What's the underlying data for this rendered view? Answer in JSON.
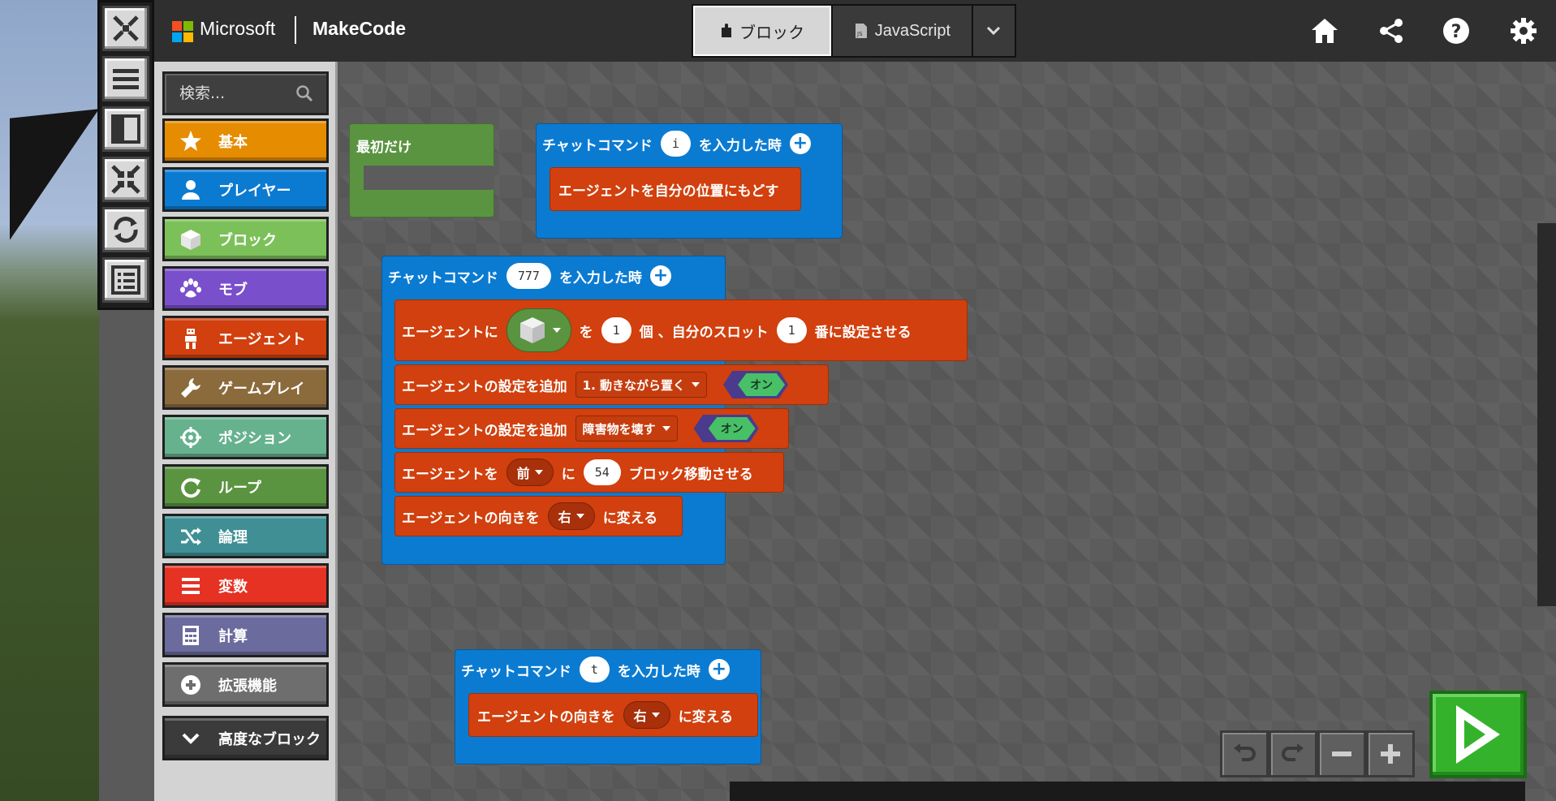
{
  "header": {
    "brand_microsoft": "Microsoft",
    "brand_product": "MakeCode",
    "editor_tabs": [
      {
        "label": "ブロック",
        "icon": "puzzle-icon",
        "active": true
      },
      {
        "label": "JavaScript",
        "icon": "js-file-icon",
        "active": false
      }
    ],
    "more_icon": "chevron-down-icon",
    "actions": [
      "home-icon",
      "share-icon",
      "help-icon",
      "settings-icon"
    ]
  },
  "minecraft_tools": [
    "close-icon",
    "menu-icon",
    "split-view-icon",
    "minimize-icon",
    "refresh-icon",
    "list-icon"
  ],
  "toolbox": {
    "search_placeholder": "検索...",
    "categories": [
      {
        "label": "基本",
        "color": "#e68c00",
        "icon": "star-icon"
      },
      {
        "label": "プレイヤー",
        "color": "#0b7bd2",
        "icon": "user-icon"
      },
      {
        "label": "ブロック",
        "color": "#7cc05a",
        "icon": "cube-icon"
      },
      {
        "label": "モブ",
        "color": "#7a4fcc",
        "icon": "paw-icon"
      },
      {
        "label": "エージェント",
        "color": "#d1400e",
        "icon": "agent-icon"
      },
      {
        "label": "ゲームプレイ",
        "color": "#8b6a3c",
        "icon": "wrench-icon"
      },
      {
        "label": "ポジション",
        "color": "#66b28e",
        "icon": "crosshair-icon"
      },
      {
        "label": "ループ",
        "color": "#5a9440",
        "icon": "loop-icon"
      },
      {
        "label": "論理",
        "color": "#3f8f95",
        "icon": "shuffle-icon"
      },
      {
        "label": "変数",
        "color": "#e53223",
        "icon": "list-lines-icon"
      },
      {
        "label": "計算",
        "color": "#6b6b9e",
        "icon": "calculator-icon"
      },
      {
        "label": "拡張機能",
        "color": "#6e6e6e",
        "icon": "plus-circle-icon"
      }
    ],
    "advanced_label": "高度なブロック"
  },
  "workspace": {
    "on_start": {
      "label": "最初だけ"
    },
    "chat_i": {
      "label_pre": "チャットコマンド",
      "command": "i",
      "label_post": "を入力した時",
      "body": "エージェントを自分の位置にもどす"
    },
    "chat_777": {
      "label_pre": "チャットコマンド",
      "command": "777",
      "label_post": "を入力した時",
      "set_item": {
        "pre": "エージェントに",
        "mid1": "を",
        "count": "1",
        "mid2": "個 、自分のスロット",
        "slot": "1",
        "post": "番に設定させる"
      },
      "setting1": {
        "pre": "エージェントの設定を追加",
        "option": "1. 動きながら置く",
        "toggle": "オン"
      },
      "setting2": {
        "pre": "エージェントの設定を追加",
        "option": "障害物を壊す",
        "toggle": "オン"
      },
      "move": {
        "pre": "エージェントを",
        "dir": "前",
        "mid": "に",
        "amount": "54",
        "post": "ブロック移動させる"
      },
      "turn": {
        "pre": "エージェントの向きを",
        "dir": "右",
        "post": "に変える"
      }
    },
    "chat_t": {
      "label_pre": "チャットコマンド",
      "command": "t",
      "label_post": "を入力した時",
      "turn": {
        "pre": "エージェントの向きを",
        "dir": "右",
        "post": "に変える"
      }
    }
  },
  "controls": [
    "undo-icon",
    "redo-icon",
    "zoom-out-icon",
    "zoom-in-icon",
    "play-icon"
  ]
}
